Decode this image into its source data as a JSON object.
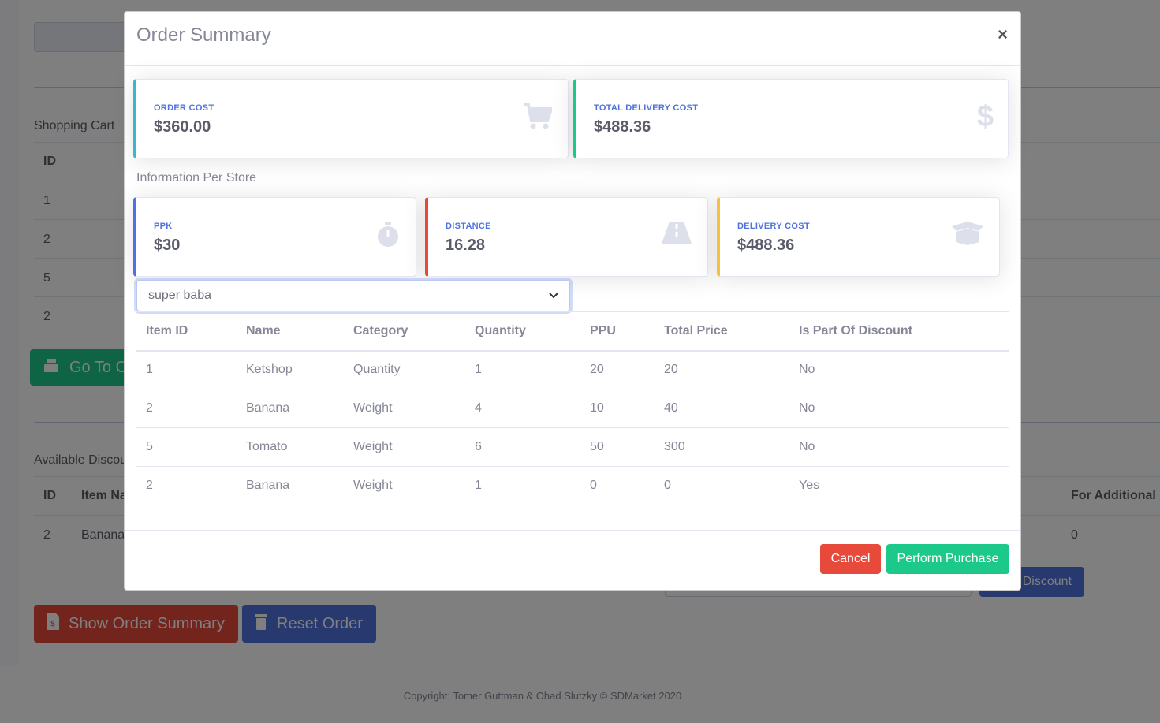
{
  "background": {
    "shopping_cart_title": "Shopping Cart",
    "cart_header_id": "ID",
    "cart_ids": [
      "1",
      "2",
      "5",
      "2"
    ],
    "go_to_button": "Go To C",
    "discounts_title": "Available Discou",
    "discount_header_id": "ID",
    "discount_header_item": "Item Na",
    "discount_header_additional": "For Additional",
    "discount_row_id": "2",
    "discount_row_item": "Banana",
    "discount_row_additional": "0",
    "discount_button": "Discount",
    "show_summary_button": "Show Order Summary",
    "reset_order_button": "Reset Order",
    "footer": "Copyright: Tomer Guttman & Ohad Slutzky © SDMarket 2020"
  },
  "modal": {
    "title": "Order Summary",
    "close": "×",
    "order_cost": {
      "label": "ORDER COST",
      "value": "$360.00"
    },
    "total_delivery_cost": {
      "label": "TOTAL DELIVERY COST",
      "value": "$488.36"
    },
    "per_store_title": "Information Per Store",
    "ppk": {
      "label": "PPK",
      "value": "$30"
    },
    "distance": {
      "label": "DISTANCE",
      "value": "16.28"
    },
    "delivery_cost": {
      "label": "DELIVERY COST",
      "value": "$488.36"
    },
    "store_select": {
      "selected": "super baba"
    },
    "table": {
      "headers": [
        "Item ID",
        "Name",
        "Category",
        "Quantity",
        "PPU",
        "Total Price",
        "Is Part Of Discount"
      ],
      "rows": [
        [
          "1",
          "Ketshop",
          "Quantity",
          "1",
          "20",
          "20",
          "No"
        ],
        [
          "2",
          "Banana",
          "Weight",
          "4",
          "10",
          "40",
          "No"
        ],
        [
          "5",
          "Tomato",
          "Weight",
          "6",
          "50",
          "300",
          "No"
        ],
        [
          "2",
          "Banana",
          "Weight",
          "1",
          "0",
          "0",
          "Yes"
        ]
      ]
    },
    "cancel_button": "Cancel",
    "perform_button": "Perform Purchase"
  }
}
